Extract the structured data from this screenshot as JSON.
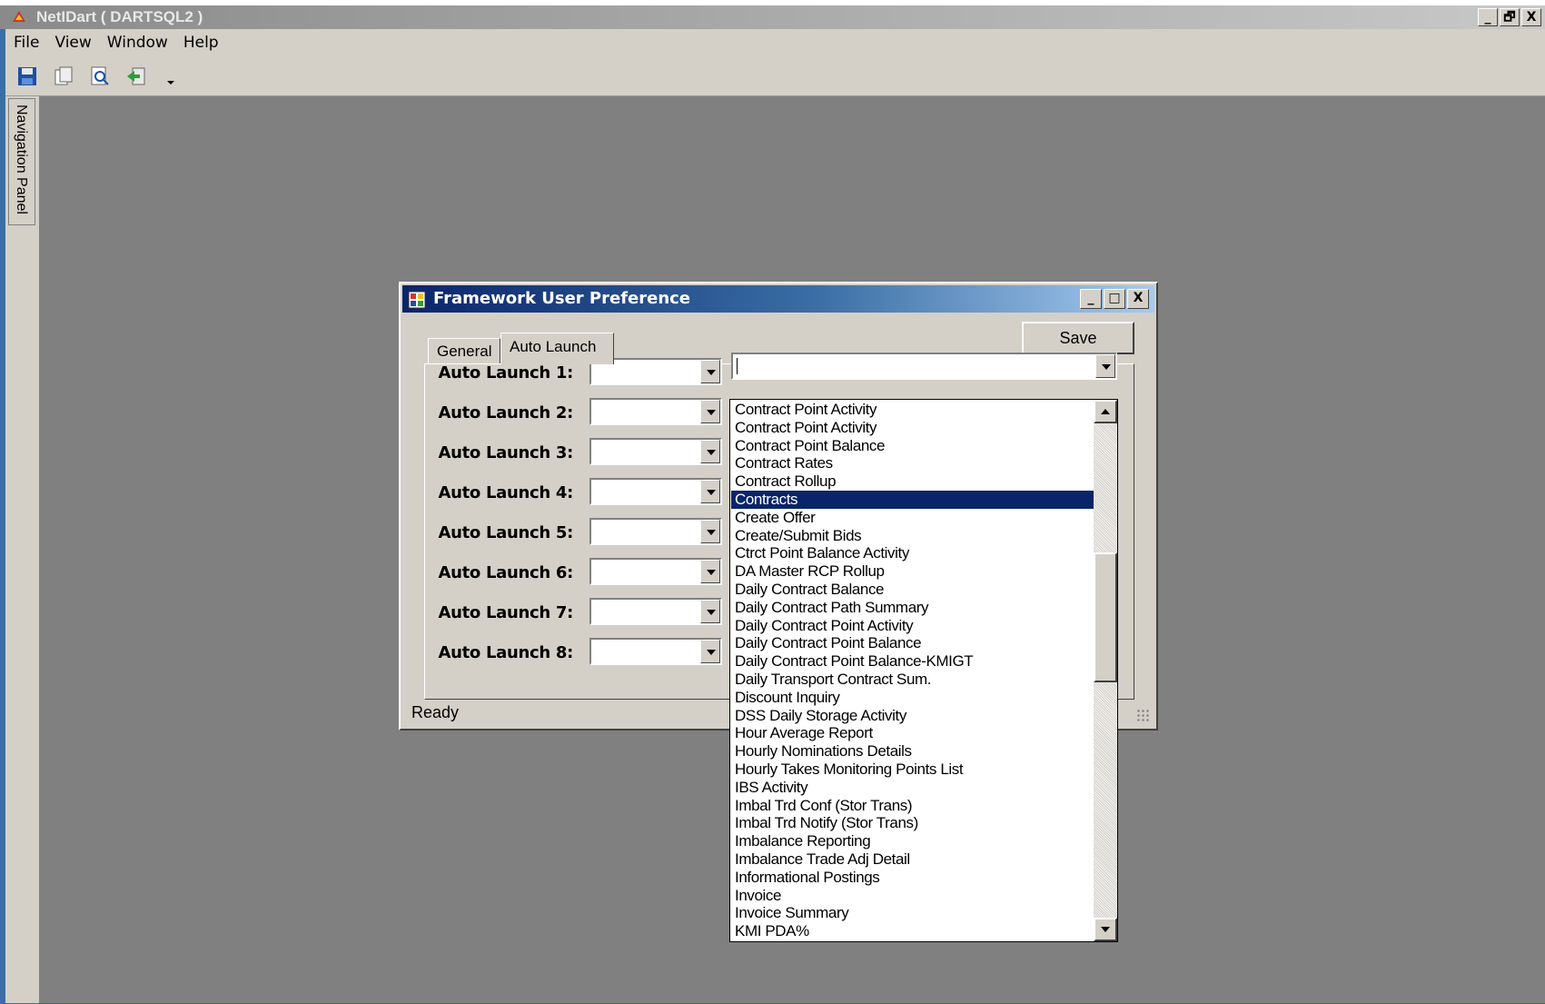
{
  "app": {
    "title": "NetIDart ( DARTSQL2 )",
    "window_buttons": [
      "_",
      "🗗",
      "X"
    ]
  },
  "menu": [
    "File",
    "View",
    "Window",
    "Help"
  ],
  "toolbar": {
    "icons": [
      "save-icon",
      "copy-icon",
      "print-preview-icon",
      "export-icon",
      "dropdown-arrow-icon"
    ]
  },
  "nav_panel": {
    "label": "Navigation Panel"
  },
  "dialog": {
    "title": "Framework User Preference",
    "window_buttons": [
      "_",
      "□",
      "X"
    ],
    "tabs": [
      "General",
      "Auto Launch"
    ],
    "active_tab": "Auto Launch",
    "save_label": "Save",
    "status": "Ready",
    "auto_launch_labels": [
      "Auto Launch 1:",
      "Auto Launch 2:",
      "Auto Launch 3:",
      "Auto Launch 4:",
      "Auto Launch 5:",
      "Auto Launch 6:",
      "Auto Launch 7:",
      "Auto Launch 8:"
    ],
    "program_combo_value": ""
  },
  "dropdown": {
    "selected": "Contracts",
    "items": [
      "Contract Point Activity",
      "Contract Point Activity",
      "Contract Point Balance",
      "Contract Rates",
      "Contract Rollup",
      "Contracts",
      "Create Offer",
      "Create/Submit Bids",
      "Ctrct Point Balance Activity",
      "DA Master RCP Rollup",
      "Daily Contract Balance",
      "Daily Contract Path Summary",
      "Daily Contract Point Activity",
      "Daily Contract Point Balance",
      "Daily Contract Point Balance-KMIGT",
      "Daily Transport Contract Sum.",
      "Discount Inquiry",
      "DSS Daily Storage Activity",
      "Hour Average Report",
      "Hourly Nominations Details",
      "Hourly Takes Monitoring Points List",
      "IBS Activity",
      "Imbal Trd Conf (Stor Trans)",
      "Imbal Trd Notify (Stor Trans)",
      "Imbalance Reporting",
      "Imbalance Trade Adj Detail",
      "Informational Postings",
      "Invoice",
      "Invoice Summary",
      "KMI PDA%"
    ]
  },
  "colors": {
    "selection": "#0a246a",
    "mdi_background": "#808080",
    "control_face": "#d4d0c8"
  }
}
